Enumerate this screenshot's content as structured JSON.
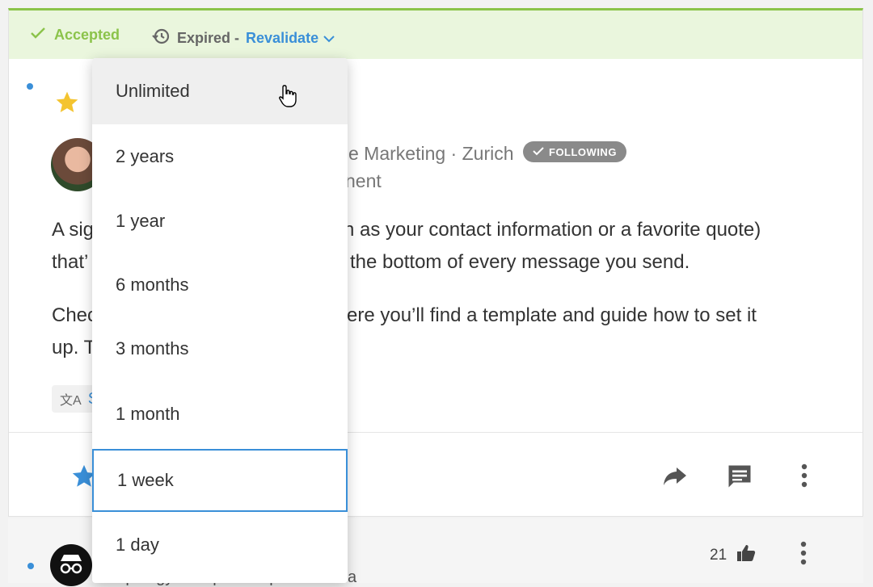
{
  "status": {
    "accepted_label": "Accepted",
    "expired_label": "Expired -",
    "revalidate_label": "Revalidate"
  },
  "post": {
    "author_meta": "e Marketing · Zurich",
    "author_role": "nent",
    "following_badge": "FOLLOWING",
    "paragraph1_line1_left": "A sig",
    "paragraph1_line1_right": "n as your contact information or a favorite quote)",
    "paragraph1_line2_left": "that’",
    "paragraph1_line2_right": "the bottom of every message you send.",
    "paragraph2_line1_left": "Chec",
    "paragraph2_line1_right": "ere you’ll find a template and guide how to set it",
    "paragraph2_line2_left": "up. T",
    "translate_label": "S"
  },
  "reply": {
    "text": "Apology Accepted Captain Needa",
    "like_count": "21"
  },
  "dropdown": {
    "options": [
      "Unlimited",
      "2 years",
      "1 year",
      "6 months",
      "3 months",
      "1 month",
      "1 week",
      "1 day"
    ],
    "hovered_index": 0,
    "selected_index": 6
  },
  "colors": {
    "accent": "#3a8fd8",
    "success": "#8bc34a",
    "star_gold": "#f4c430",
    "status_bg": "#eaf6dd"
  },
  "icons": {
    "accepted": "check-icon",
    "expired": "history-icon",
    "revalidate": "chevron-down-icon",
    "share": "share-arrow-icon",
    "comment": "comment-icon",
    "more": "more-vertical-icon",
    "like": "thumbs-up-icon"
  }
}
